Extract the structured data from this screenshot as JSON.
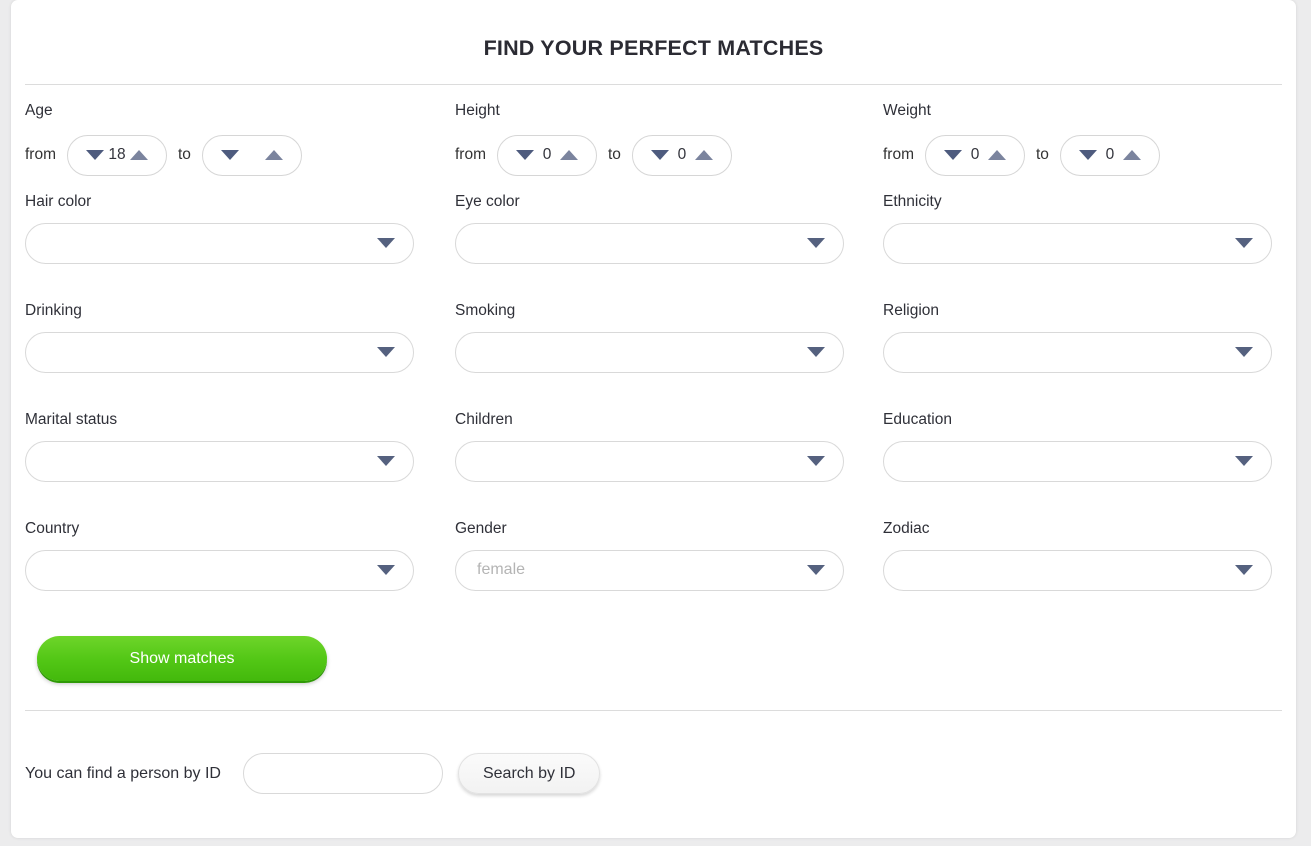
{
  "page": {
    "title": "FIND YOUR PERFECT MATCHES"
  },
  "ranges": [
    {
      "label": "Age",
      "from_word": "from",
      "to_word": "to",
      "from_value": "18",
      "to_value": ""
    },
    {
      "label": "Height",
      "from_word": "from",
      "to_word": "to",
      "from_value": "0",
      "to_value": "0"
    },
    {
      "label": "Weight",
      "from_word": "from",
      "to_word": "to",
      "from_value": "0",
      "to_value": "0"
    }
  ],
  "selects": [
    {
      "label": "Hair color",
      "value": "",
      "is_placeholder": false
    },
    {
      "label": "Eye color",
      "value": "",
      "is_placeholder": false
    },
    {
      "label": "Ethnicity",
      "value": "",
      "is_placeholder": false
    },
    {
      "label": "Drinking",
      "value": "",
      "is_placeholder": false
    },
    {
      "label": "Smoking",
      "value": "",
      "is_placeholder": false
    },
    {
      "label": "Religion",
      "value": "",
      "is_placeholder": false
    },
    {
      "label": "Marital status",
      "value": "",
      "is_placeholder": false
    },
    {
      "label": "Children",
      "value": "",
      "is_placeholder": false
    },
    {
      "label": "Education",
      "value": "",
      "is_placeholder": false
    },
    {
      "label": "Country",
      "value": "",
      "is_placeholder": false
    },
    {
      "label": "Gender",
      "value": "female",
      "is_placeholder": true
    },
    {
      "label": "Zodiac",
      "value": "",
      "is_placeholder": false
    }
  ],
  "submit": {
    "label": "Show matches"
  },
  "find_by_id": {
    "label": "You can find a person by ID",
    "input_value": "",
    "input_placeholder": "",
    "button_label": "Search by ID"
  },
  "icons": {
    "spinner_down": "triangle-down-icon",
    "spinner_up": "triangle-up-icon",
    "select_caret": "chevron-down-icon"
  },
  "colors": {
    "accent_green": "#53c716",
    "caret_blue": "#55617f",
    "text": "#2f3038",
    "border": "#d9d9d9"
  }
}
